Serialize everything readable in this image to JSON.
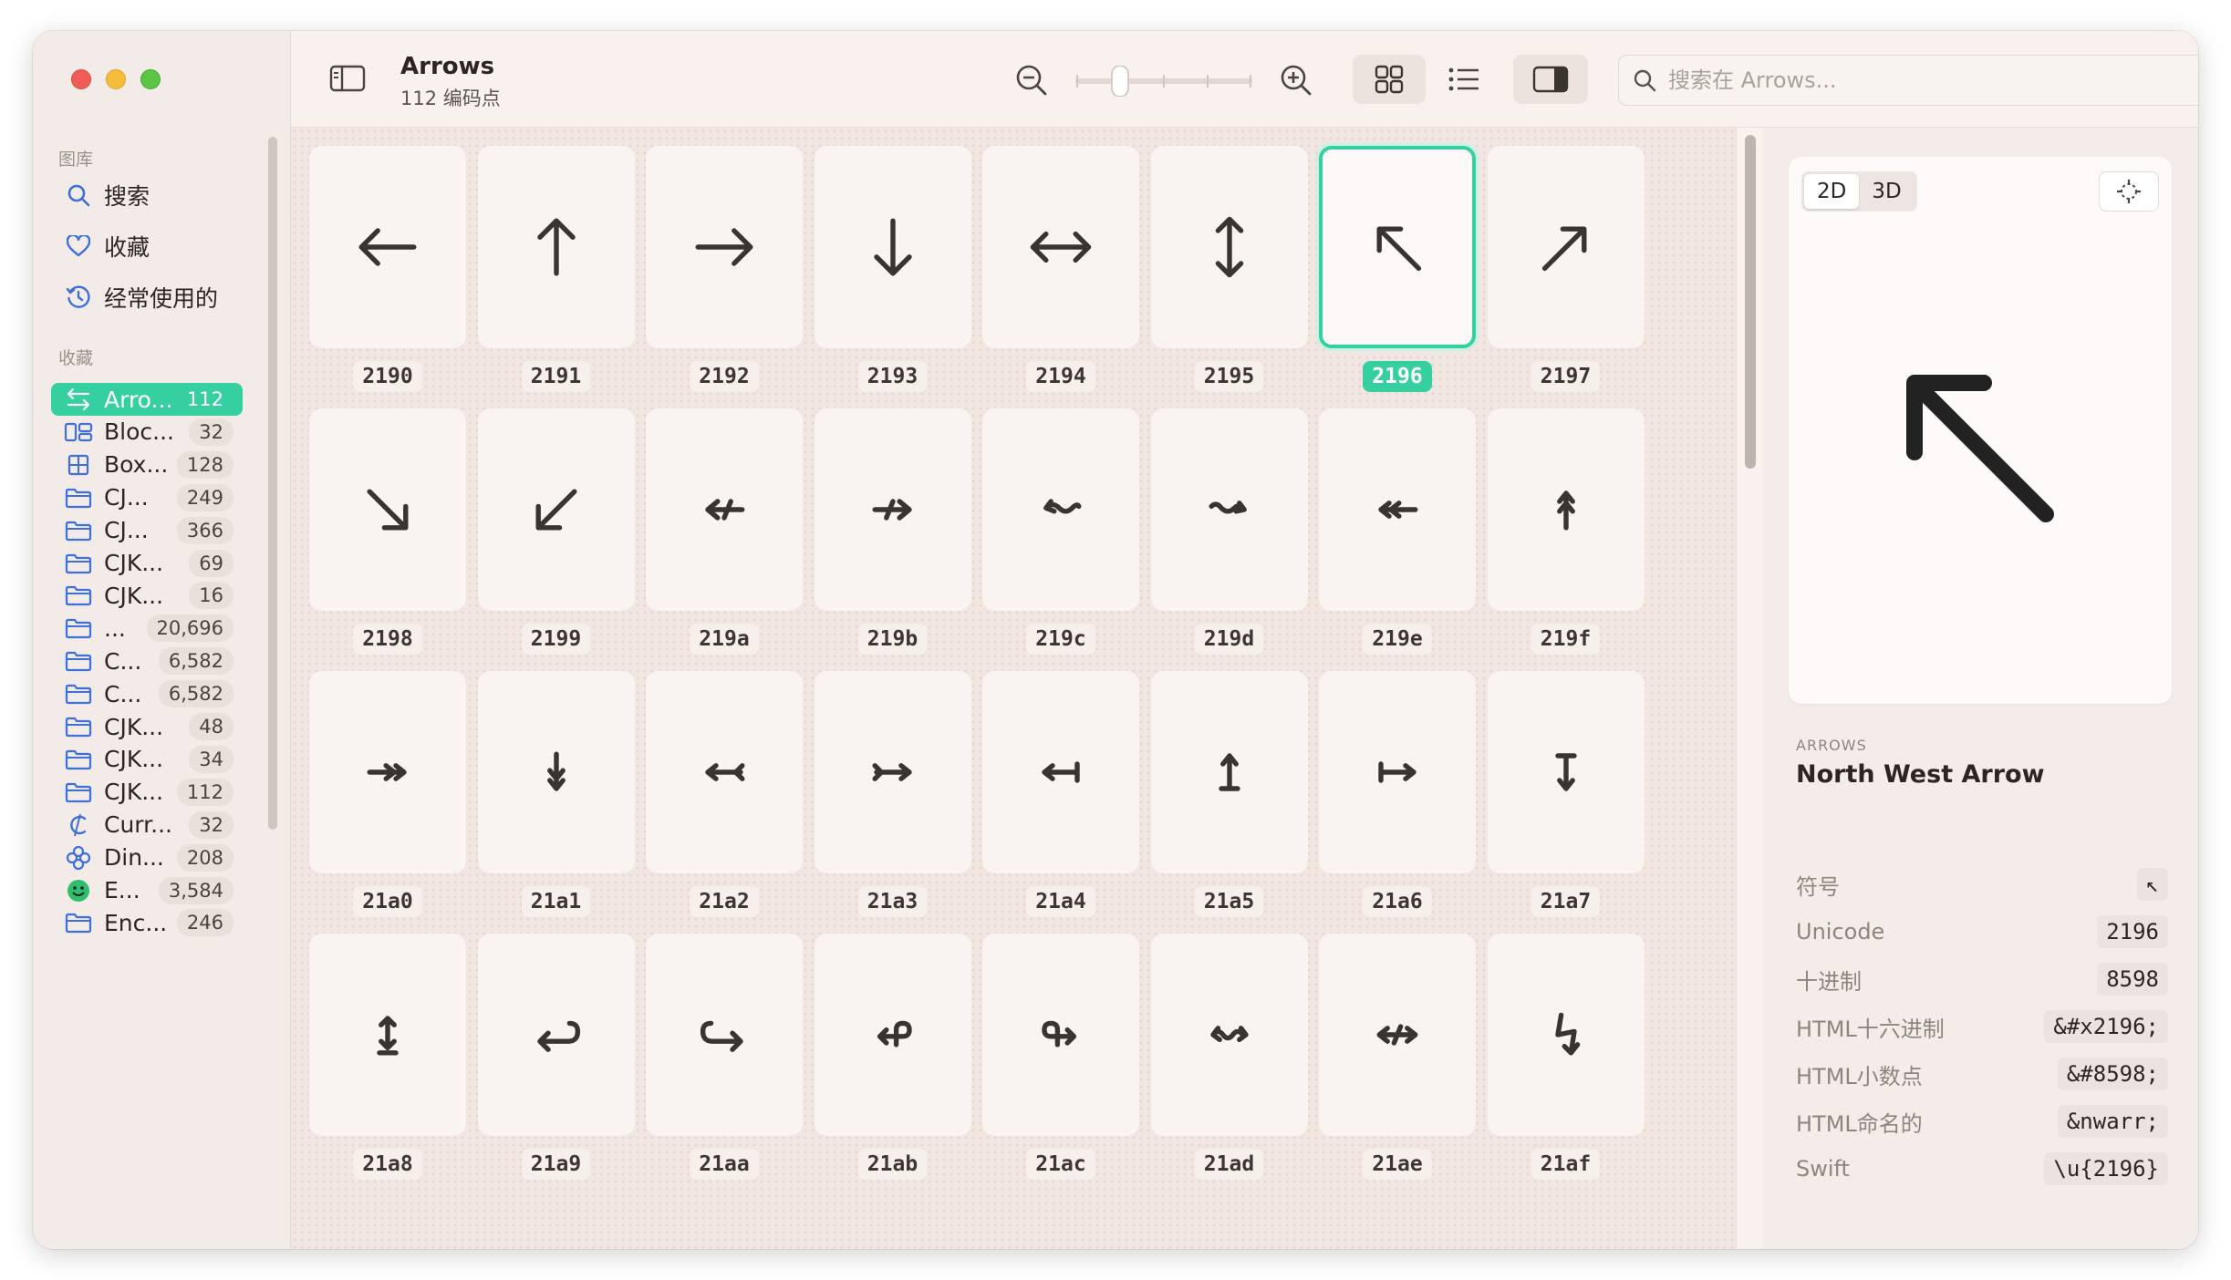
{
  "toolbar": {
    "title": "Arrows",
    "subtitle": "112 编码点",
    "search_placeholder": "搜索在 Arrows..."
  },
  "sidebar": {
    "library_header": "图库",
    "library_items": [
      {
        "label": "搜索",
        "icon": "search-icon"
      },
      {
        "label": "收藏",
        "icon": "heart-icon"
      },
      {
        "label": "经常使用的",
        "icon": "history-icon"
      }
    ],
    "collections_header": "收藏",
    "collections": [
      {
        "label": "Arro...",
        "count": "112",
        "icon": "arrows-icon",
        "active": true
      },
      {
        "label": "Bloc...",
        "count": "32",
        "icon": "blocks-icon"
      },
      {
        "label": "Box...",
        "count": "128",
        "icon": "box-drawing-icon"
      },
      {
        "label": "CJ...",
        "count": "249",
        "icon": "folder-icon"
      },
      {
        "label": "CJ...",
        "count": "366",
        "icon": "folder-icon"
      },
      {
        "label": "CJK...",
        "count": "69",
        "icon": "folder-icon"
      },
      {
        "label": "CJK...",
        "count": "16",
        "icon": "folder-icon"
      },
      {
        "label": "...",
        "count": "20,696",
        "icon": "folder-icon"
      },
      {
        "label": "C...",
        "count": "6,582",
        "icon": "folder-icon"
      },
      {
        "label": "C...",
        "count": "6,582",
        "icon": "folder-icon"
      },
      {
        "label": "CJK...",
        "count": "48",
        "icon": "folder-icon"
      },
      {
        "label": "CJK...",
        "count": "34",
        "icon": "folder-icon"
      },
      {
        "label": "CJK...",
        "count": "112",
        "icon": "folder-icon"
      },
      {
        "label": "Curr...",
        "count": "32",
        "icon": "currency-icon"
      },
      {
        "label": "Din...",
        "count": "208",
        "icon": "dingbat-icon"
      },
      {
        "label": "E...",
        "count": "3,584",
        "icon": "emoji-icon"
      },
      {
        "label": "Enc...",
        "count": "246",
        "icon": "folder-icon"
      }
    ]
  },
  "grid": {
    "selected": "2196",
    "items": [
      {
        "code": "2190",
        "glyph": "leftwards-arrow"
      },
      {
        "code": "2191",
        "glyph": "upwards-arrow"
      },
      {
        "code": "2192",
        "glyph": "rightwards-arrow"
      },
      {
        "code": "2193",
        "glyph": "downwards-arrow"
      },
      {
        "code": "2194",
        "glyph": "left-right-arrow"
      },
      {
        "code": "2195",
        "glyph": "up-down-arrow"
      },
      {
        "code": "2196",
        "glyph": "north-west-arrow"
      },
      {
        "code": "2197",
        "glyph": "north-east-arrow"
      },
      {
        "code": "2198",
        "glyph": "south-east-arrow"
      },
      {
        "code": "2199",
        "glyph": "south-west-arrow"
      },
      {
        "code": "219a",
        "glyph": "leftwards-arrow-with-stroke"
      },
      {
        "code": "219b",
        "glyph": "rightwards-arrow-with-stroke"
      },
      {
        "code": "219c",
        "glyph": "leftwards-wave-arrow"
      },
      {
        "code": "219d",
        "glyph": "rightwards-wave-arrow"
      },
      {
        "code": "219e",
        "glyph": "leftwards-two-headed-arrow"
      },
      {
        "code": "219f",
        "glyph": "upwards-two-headed-arrow"
      },
      {
        "code": "21a0",
        "glyph": "rightwards-two-headed-arrow"
      },
      {
        "code": "21a1",
        "glyph": "downwards-two-headed-arrow"
      },
      {
        "code": "21a2",
        "glyph": "leftwards-arrow-with-tail"
      },
      {
        "code": "21a3",
        "glyph": "rightwards-arrow-with-tail"
      },
      {
        "code": "21a4",
        "glyph": "leftwards-arrow-from-bar"
      },
      {
        "code": "21a5",
        "glyph": "upwards-arrow-from-bar"
      },
      {
        "code": "21a6",
        "glyph": "rightwards-arrow-from-bar"
      },
      {
        "code": "21a7",
        "glyph": "downwards-arrow-from-bar"
      },
      {
        "code": "21a8",
        "glyph": "up-down-arrow-with-base"
      },
      {
        "code": "21a9",
        "glyph": "leftwards-arrow-with-hook"
      },
      {
        "code": "21aa",
        "glyph": "rightwards-arrow-with-hook"
      },
      {
        "code": "21ab",
        "glyph": "leftwards-arrow-with-loop"
      },
      {
        "code": "21ac",
        "glyph": "rightwards-arrow-with-loop"
      },
      {
        "code": "21ad",
        "glyph": "left-right-wave-arrow"
      },
      {
        "code": "21ae",
        "glyph": "left-right-arrow-with-stroke"
      },
      {
        "code": "21af",
        "glyph": "downwards-zigzag-arrow"
      }
    ]
  },
  "inspector": {
    "mode_2d": "2D",
    "mode_3d": "3D",
    "category": "ARROWS",
    "name": "North West Arrow",
    "properties": [
      {
        "key": "符号",
        "value": "↖"
      },
      {
        "key": "Unicode",
        "value": "2196"
      },
      {
        "key": "十进制",
        "value": "8598"
      },
      {
        "key": "HTML十六进制",
        "value": "&#x2196;"
      },
      {
        "key": "HTML小数点",
        "value": "&#8598;"
      },
      {
        "key": "HTML命名的",
        "value": "&nwarr;"
      },
      {
        "key": "Swift",
        "value": "\\u{2196}"
      }
    ]
  },
  "colors": {
    "accent": "#35cfa0",
    "glyph": "#3a3431"
  }
}
